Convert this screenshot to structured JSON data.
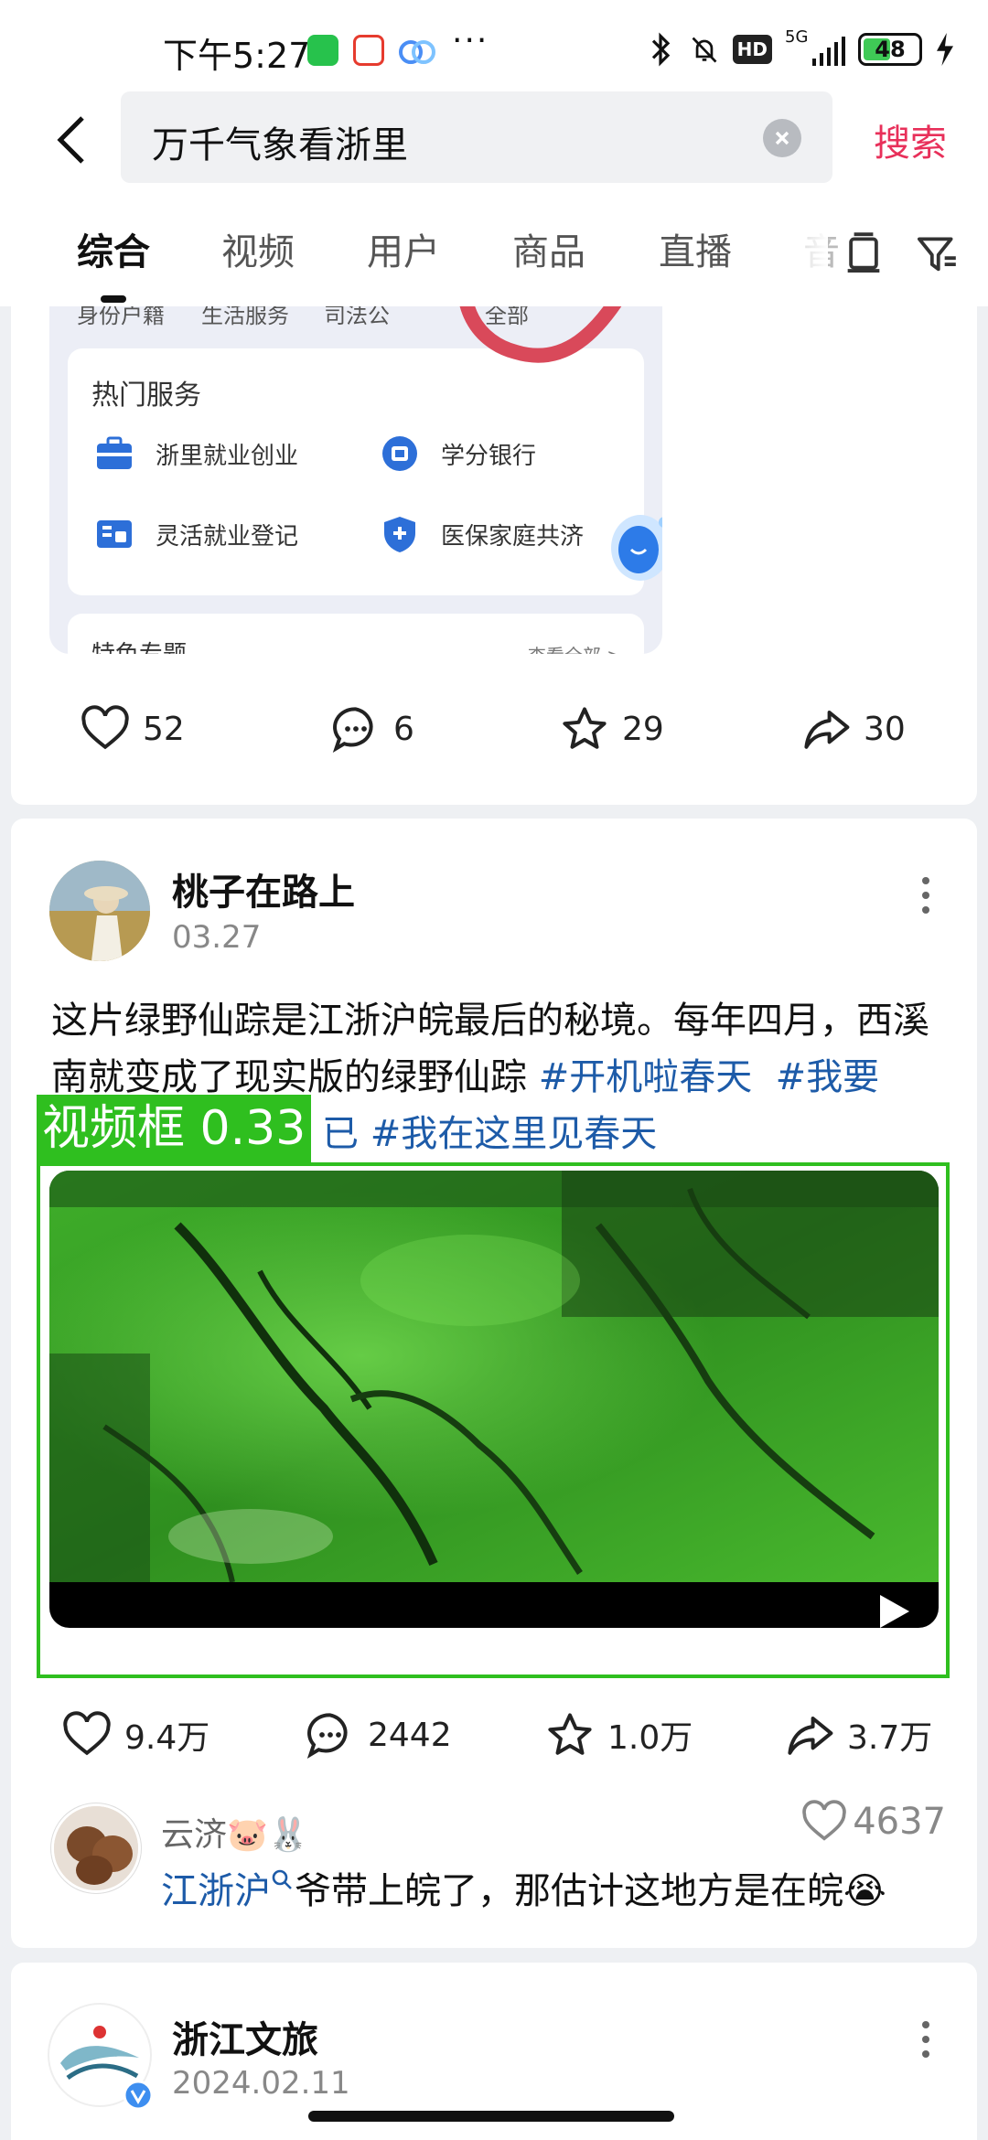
{
  "status_bar": {
    "time": "下午5:27",
    "dots": "···",
    "hd": "HD",
    "network": "5G",
    "battery": "48"
  },
  "search": {
    "query": "万千气象看浙里",
    "button": "搜索"
  },
  "tabs": [
    "综合",
    "视频",
    "用户",
    "商品",
    "直播",
    "音"
  ],
  "embed": {
    "top_items": [
      "身份户籍",
      "生活服务",
      "司法公",
      "全部"
    ],
    "section_title": "热门服务",
    "services": [
      "浙里就业创业",
      "学分银行",
      "灵活就业登记",
      "医保家庭共济"
    ],
    "lower_title": "特色专题",
    "lower_more": "查看全部 >"
  },
  "post1_actions": {
    "likes": "52",
    "comments": "6",
    "favorites": "29",
    "shares": "30"
  },
  "post2": {
    "author": "桃子在路上",
    "date": "03.27",
    "text_plain": "这片绿野仙踪是江浙沪皖最后的秘境。每年四月，西溪南就变成了现实版的绿野仙踪 ",
    "tag1": "#开机啦春天",
    "tag2": "#我要",
    "tag2_cont": "已",
    "tag3": "#我在这里见春天",
    "actions": {
      "likes": "9.4万",
      "comments": "2442",
      "favorites": "1.0万",
      "shares": "3.7万"
    },
    "comment": {
      "user": "云济🐷🐰",
      "likes": "4637",
      "link": "江浙沪",
      "text": "爷带上皖了，那估计这地方是在皖😭"
    }
  },
  "detection": {
    "label": "视频框 0.33"
  },
  "post3": {
    "author": "浙江文旅",
    "date": "2024.02.11"
  },
  "colors": {
    "accent": "#e8305a",
    "tag": "#1d5ba8",
    "detect": "#2fbf1f"
  }
}
